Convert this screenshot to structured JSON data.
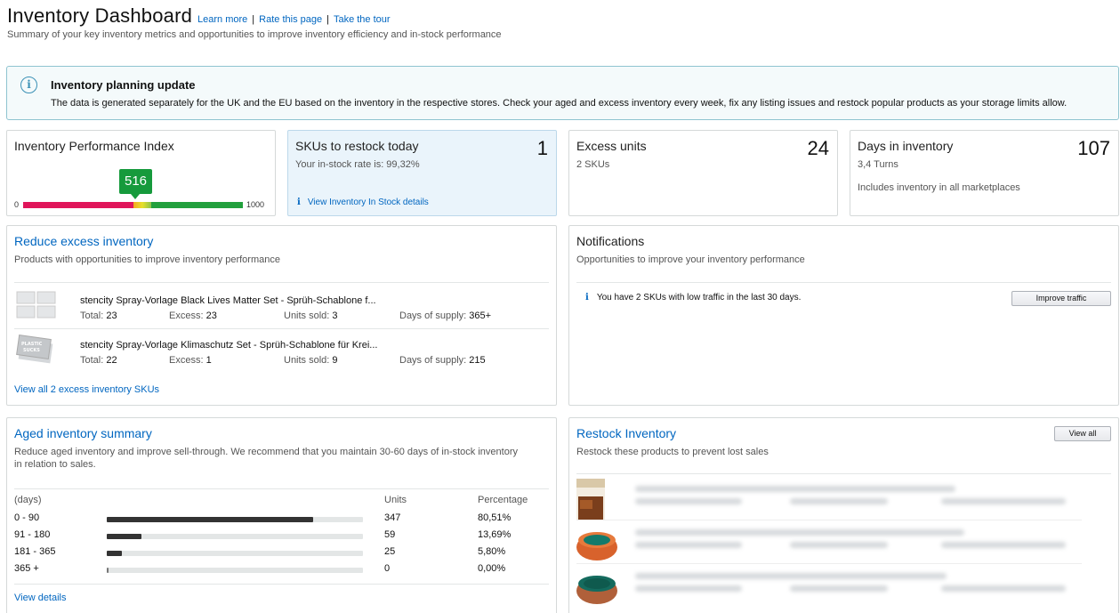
{
  "header": {
    "title": "Inventory Dashboard",
    "links": [
      "Learn more",
      "Rate this page",
      "Take the tour"
    ],
    "subtitle": "Summary of your key inventory metrics and opportunities to improve inventory efficiency and in-stock performance"
  },
  "alert": {
    "icon": "info-icon",
    "title": "Inventory planning update",
    "text": "The data is generated separately for the UK and the EU based on the inventory in the respective stores. Check your aged and excess inventory every week, fix any listing issues and restock popular products as your storage limits allow."
  },
  "ipi": {
    "title": "Inventory Performance Index",
    "score": "516",
    "min": "0",
    "max": "1000",
    "colors": {
      "low": "#e0155a",
      "high": "#22a03d",
      "badge": "#169a3c"
    }
  },
  "restock_today": {
    "title": "SKUs to restock today",
    "value": "1",
    "sub": "Your in-stock rate is: 99,32%",
    "link": "View Inventory In Stock details"
  },
  "excess_units": {
    "title": "Excess units",
    "value": "24",
    "sub": "2 SKUs"
  },
  "days_inventory": {
    "title": "Days in inventory",
    "value": "107",
    "sub": "3,4 Turns",
    "note": "Includes inventory in all marketplaces"
  },
  "reduce_excess": {
    "title": "Reduce excess inventory",
    "sub": "Products with opportunities to improve inventory performance",
    "stat_labels": {
      "total": "Total:",
      "excess": "Excess:",
      "sold": "Units sold:",
      "supply": "Days of supply:"
    },
    "items": [
      {
        "name": "stencity Spray-Vorlage Black Lives Matter Set - Sprüh-Schablone f...",
        "total": "23",
        "excess": "23",
        "sold": "3",
        "supply": "365+"
      },
      {
        "name": "stencity Spray-Vorlage Klimaschutz Set - Sprüh-Schablone für Krei...",
        "total": "22",
        "excess": "1",
        "sold": "9",
        "supply": "215"
      }
    ],
    "view_all": "View all 2 excess inventory SKUs"
  },
  "notifications": {
    "title": "Notifications",
    "sub": "Opportunities to improve your inventory performance",
    "message": "You have 2 SKUs with low traffic in the last 30 days.",
    "button": "Improve traffic"
  },
  "aged": {
    "title": "Aged inventory summary",
    "sub_line1": "Reduce aged inventory and improve sell-through. We recommend that you maintain 30-60 days of in-stock inventory",
    "sub_line2": "in relation to sales.",
    "headers": {
      "days": "(days)",
      "units": "Units",
      "pct": "Percentage"
    },
    "rows": [
      {
        "label": "0 - 90",
        "units": "347",
        "pct": "80,51%",
        "fraction": 0.8051
      },
      {
        "label": "91 - 180",
        "units": "59",
        "pct": "13,69%",
        "fraction": 0.1369
      },
      {
        "label": "181 - 365",
        "units": "25",
        "pct": "5,80%",
        "fraction": 0.058
      },
      {
        "label": "365 +",
        "units": "0",
        "pct": "0,00%",
        "fraction": 0.0
      }
    ],
    "view_details": "View details"
  },
  "restock": {
    "title": "Restock Inventory",
    "sub": "Restock these products to prevent lost sales",
    "button": "View all"
  }
}
